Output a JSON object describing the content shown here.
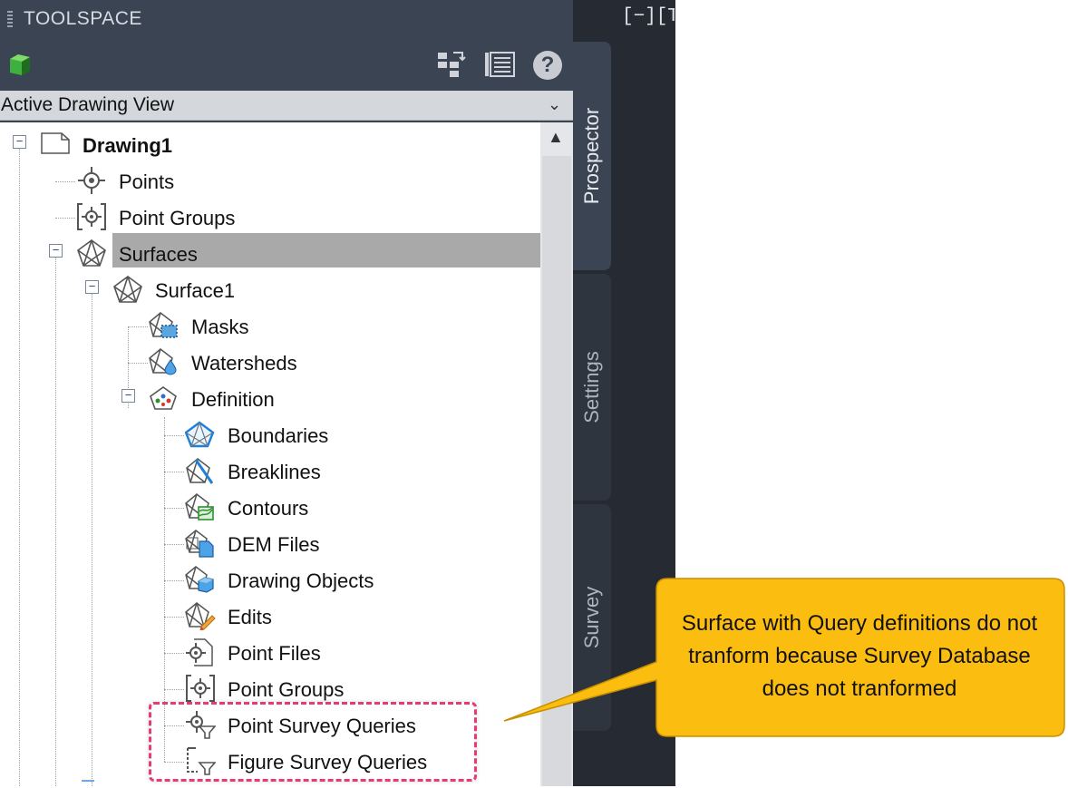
{
  "panel": {
    "title": "TOOLSPACE",
    "view_selector": "Active Drawing View",
    "help_label": "?"
  },
  "tree": {
    "root": "Drawing1",
    "points": "Points",
    "point_groups": "Point Groups",
    "surfaces": "Surfaces",
    "surface1": "Surface1",
    "masks": "Masks",
    "watersheds": "Watersheds",
    "definition": "Definition",
    "boundaries": "Boundaries",
    "breaklines": "Breaklines",
    "contours": "Contours",
    "dem_files": "DEM Files",
    "drawing_objects": "Drawing Objects",
    "edits": "Edits",
    "point_files": "Point Files",
    "def_point_groups": "Point Groups",
    "point_survey_queries": "Point Survey Queries",
    "figure_survey_queries": "Figure Survey Queries"
  },
  "tabs": {
    "prospector": "Prospector",
    "settings": "Settings",
    "survey": "Survey"
  },
  "viewport": {
    "label": "[−][To"
  },
  "callout": {
    "text": "Surface with Query definitions do not tranform because Survey Database does not tranformed"
  },
  "colors": {
    "panel_bg": "#3b4453",
    "selection": "#a9a9a9",
    "callout_fill": "#fbbd10",
    "highlight_border": "#e63b74"
  }
}
